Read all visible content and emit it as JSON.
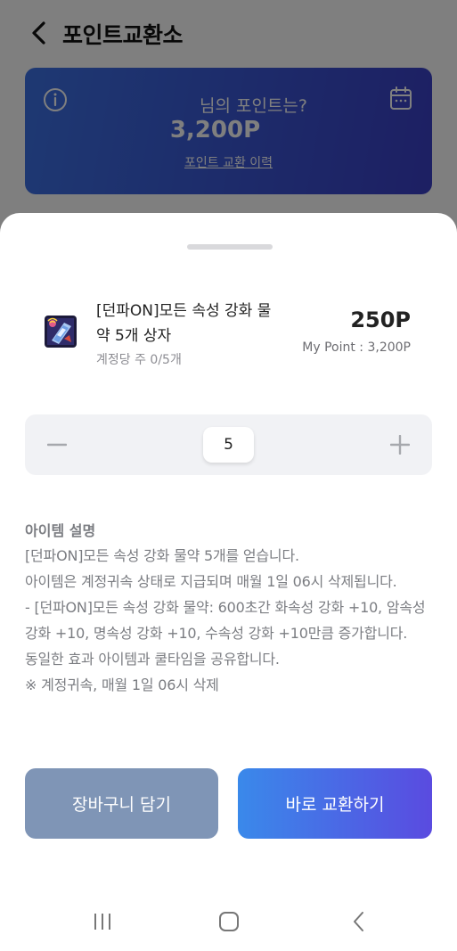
{
  "header": {
    "title": "포인트교환소"
  },
  "point_card": {
    "label": "님의 포인트는?",
    "value": "3,200P",
    "history_link": "포인트 교환 이력"
  },
  "item": {
    "name": "[던파ON]모든 속성 강화 물약 5개 상자",
    "limit": "계정당 주 0/5개",
    "price": "250P",
    "my_point": "My Point : 3,200P"
  },
  "stepper": {
    "quantity": "5"
  },
  "description": {
    "title": "아이템 설명",
    "lines": [
      "[던파ON]모든 속성 강화 물약 5개를 얻습니다.",
      "아이템은 계정귀속 상태로 지급되며 매월 1일 06시 삭제됩니다.",
      "- [던파ON]모든 속성 강화 물약: 600초간 화속성 강화 +10, 암속성 강화 +10, 명속성 강화 +10, 수속성 강화 +10만큼 증가합니다.",
      "동일한 효과 아이템과 쿨타임을 공유합니다.",
      "※ 계정귀속, 매월 1일 06시 삭제"
    ]
  },
  "buttons": {
    "cart": "장바구니 담기",
    "exchange": "바로 교환하기"
  },
  "colors": {
    "card_gradient_start": "#3d72e6",
    "card_gradient_end": "#3b3fc6",
    "cart_button": "#7f95b6",
    "exchange_gradient_start": "#3a89ea",
    "exchange_gradient_end": "#5a4be0"
  },
  "icons": {
    "back": "chevron-left-icon",
    "info": "info-icon",
    "calendar": "calendar-icon",
    "minus": "minus-icon",
    "plus": "plus-icon",
    "recent_apps": "recent-apps-icon",
    "home": "home-icon",
    "nav_back": "nav-back-icon"
  }
}
